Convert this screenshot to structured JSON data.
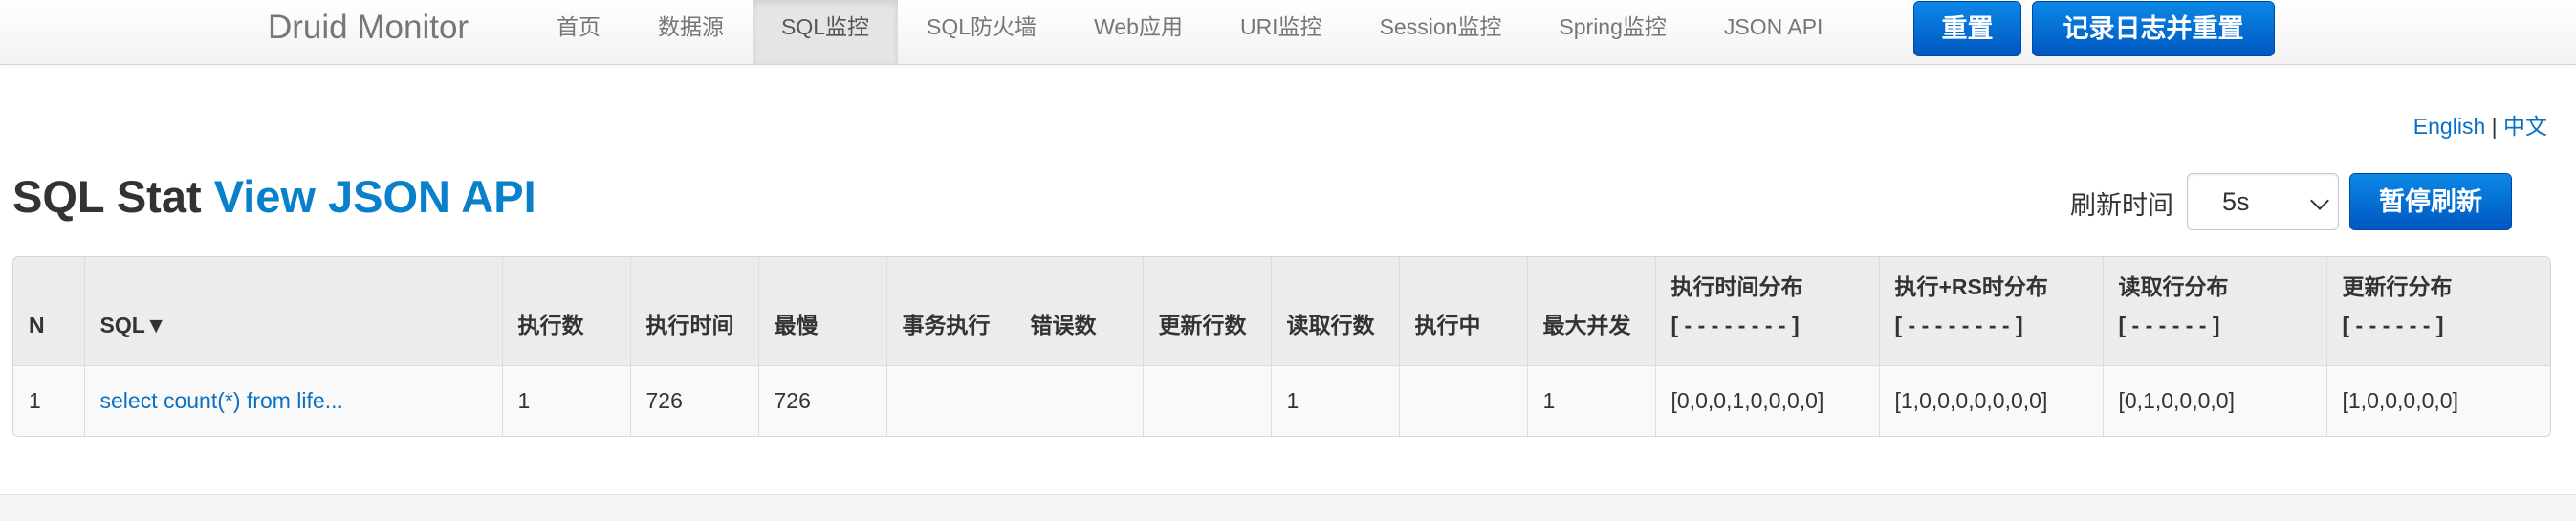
{
  "navbar": {
    "brand": "Druid Monitor",
    "items": [
      {
        "label": "首页"
      },
      {
        "label": "数据源"
      },
      {
        "label": "SQL监控",
        "active": true
      },
      {
        "label": "SQL防火墙"
      },
      {
        "label": "Web应用"
      },
      {
        "label": "URI监控"
      },
      {
        "label": "Session监控"
      },
      {
        "label": "Spring监控"
      },
      {
        "label": "JSON API"
      }
    ],
    "reset_label": "重置",
    "log_reset_label": "记录日志并重置"
  },
  "lang": {
    "english": "English",
    "separator": "|",
    "chinese": "中文"
  },
  "page": {
    "title": "SQL Stat",
    "json_link": "View JSON API"
  },
  "refresh": {
    "label": "刷新时间",
    "selected": "5s",
    "pause_label": "暂停刷新"
  },
  "table": {
    "headers": [
      {
        "line1": "N",
        "line2": ""
      },
      {
        "line1": "SQL▼",
        "line2": ""
      },
      {
        "line1": "执行数",
        "line2": ""
      },
      {
        "line1": "执行时间",
        "line2": ""
      },
      {
        "line1": "最慢",
        "line2": ""
      },
      {
        "line1": "事务执行",
        "line2": ""
      },
      {
        "line1": "错误数",
        "line2": ""
      },
      {
        "line1": "更新行数",
        "line2": ""
      },
      {
        "line1": "读取行数",
        "line2": ""
      },
      {
        "line1": "执行中",
        "line2": ""
      },
      {
        "line1": "最大并发",
        "line2": ""
      },
      {
        "line1": "执行时间分布",
        "line2": "[ - - - - - - - - ]"
      },
      {
        "line1": "执行+RS时分布",
        "line2": "[ - - - - - - - - ]"
      },
      {
        "line1": "读取行分布",
        "line2": "[ - - - - - - ]"
      },
      {
        "line1": "更新行分布",
        "line2": "[ - - - - - - ]"
      }
    ],
    "rows": [
      [
        "1",
        "select count(*) from life...",
        "1",
        "726",
        "726",
        "",
        "",
        "",
        "1",
        "",
        "1",
        "[0,0,0,1,0,0,0,0]",
        "[1,0,0,0,0,0,0,0]",
        "[0,1,0,0,0,0]",
        "[1,0,0,0,0,0]"
      ]
    ]
  },
  "colors": {
    "accent": "#0a80cc",
    "primary_button": "#0068d6",
    "header_bg": "#ececec"
  }
}
